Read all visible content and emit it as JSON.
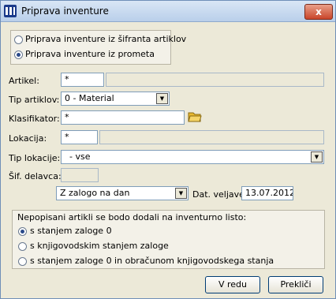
{
  "window": {
    "title": "Priprava inventure",
    "close_label": "x"
  },
  "source": {
    "options": [
      {
        "label": "Priprava inventure iz šifranta artiklov",
        "selected": false
      },
      {
        "label": "Priprava inventure iz prometa",
        "selected": true
      }
    ]
  },
  "form": {
    "artikel": {
      "label": "Artikel:",
      "value": "*"
    },
    "tip_artiklov": {
      "label": "Tip artiklov:",
      "value": "0 - Material"
    },
    "klasifikator": {
      "label": "Klasifikator:",
      "value": "*"
    },
    "lokacija": {
      "label": "Lokacija:",
      "value": "*"
    },
    "tip_lokacije": {
      "label": "Tip lokacije:",
      "value": " - vse"
    },
    "sif_delavca": {
      "label": "Šif. delavca:",
      "value": ""
    },
    "zaloga": {
      "value": "Z zalogo na dan"
    },
    "dat_veljave": {
      "label": "Dat. veljave:",
      "value": "13.07.2012"
    }
  },
  "unwritten": {
    "heading": "Nepopisani artikli se bodo dodali na inventurno listo:",
    "options": [
      {
        "label": "s stanjem zaloge 0",
        "selected": true
      },
      {
        "label": "s knjigovodskim stanjem zaloge",
        "selected": false
      },
      {
        "label": "s stanjem zaloge 0 in obračunom knjigovodskega stanja",
        "selected": false
      }
    ]
  },
  "buttons": {
    "ok": "V redu",
    "cancel": "Prekliči"
  },
  "colors": {
    "dialog_bg": "#ece9d8",
    "titlebar": "#c8dbf0",
    "close": "#c9452a"
  }
}
